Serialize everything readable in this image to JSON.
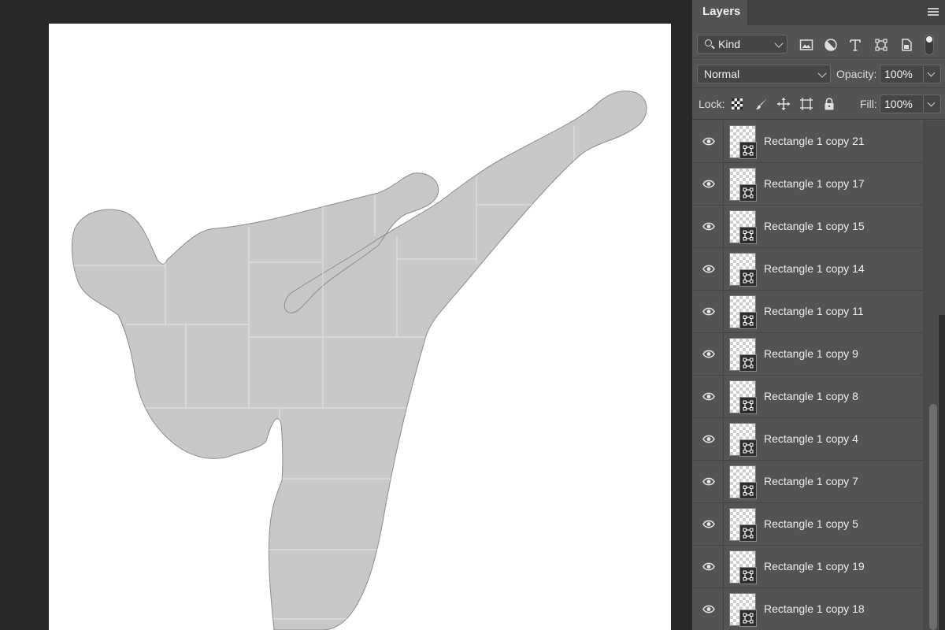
{
  "panel": {
    "tab_label": "Layers",
    "filter": {
      "kind_label": "Kind",
      "icons": [
        "pixel-layer-filter-icon",
        "adjustment-layer-filter-icon",
        "type-layer-filter-icon",
        "shape-layer-filter-icon",
        "smart-object-filter-icon"
      ]
    },
    "blend_mode": "Normal",
    "opacity_label": "Opacity:",
    "opacity_value": "100%",
    "lock_label": "Lock:",
    "lock_icons": [
      "lock-transparent-pixels-icon",
      "lock-image-pixels-icon",
      "lock-position-icon",
      "lock-artboard-icon",
      "lock-all-icon"
    ],
    "fill_label": "Fill:",
    "fill_value": "100%"
  },
  "layers": [
    {
      "name": "Rectangle 1 copy 21",
      "visible": true
    },
    {
      "name": "Rectangle 1 copy 17",
      "visible": true
    },
    {
      "name": "Rectangle 1 copy 15",
      "visible": true
    },
    {
      "name": "Rectangle 1 copy 14",
      "visible": true
    },
    {
      "name": "Rectangle 1 copy 11",
      "visible": true
    },
    {
      "name": "Rectangle 1 copy 9",
      "visible": true
    },
    {
      "name": "Rectangle 1 copy 8",
      "visible": true
    },
    {
      "name": "Rectangle 1 copy 4",
      "visible": true
    },
    {
      "name": "Rectangle 1 copy 7",
      "visible": true
    },
    {
      "name": "Rectangle 1 copy 5",
      "visible": true
    },
    {
      "name": "Rectangle 1 copy 19",
      "visible": true
    },
    {
      "name": "Rectangle 1 copy 18",
      "visible": true
    }
  ],
  "colors": {
    "canvas_bg": "#282828",
    "document": "#ffffff",
    "silhouette_fill": "#c8c8c8",
    "tile_lines": "#e6e6e6",
    "panel_bg": "#535353"
  }
}
